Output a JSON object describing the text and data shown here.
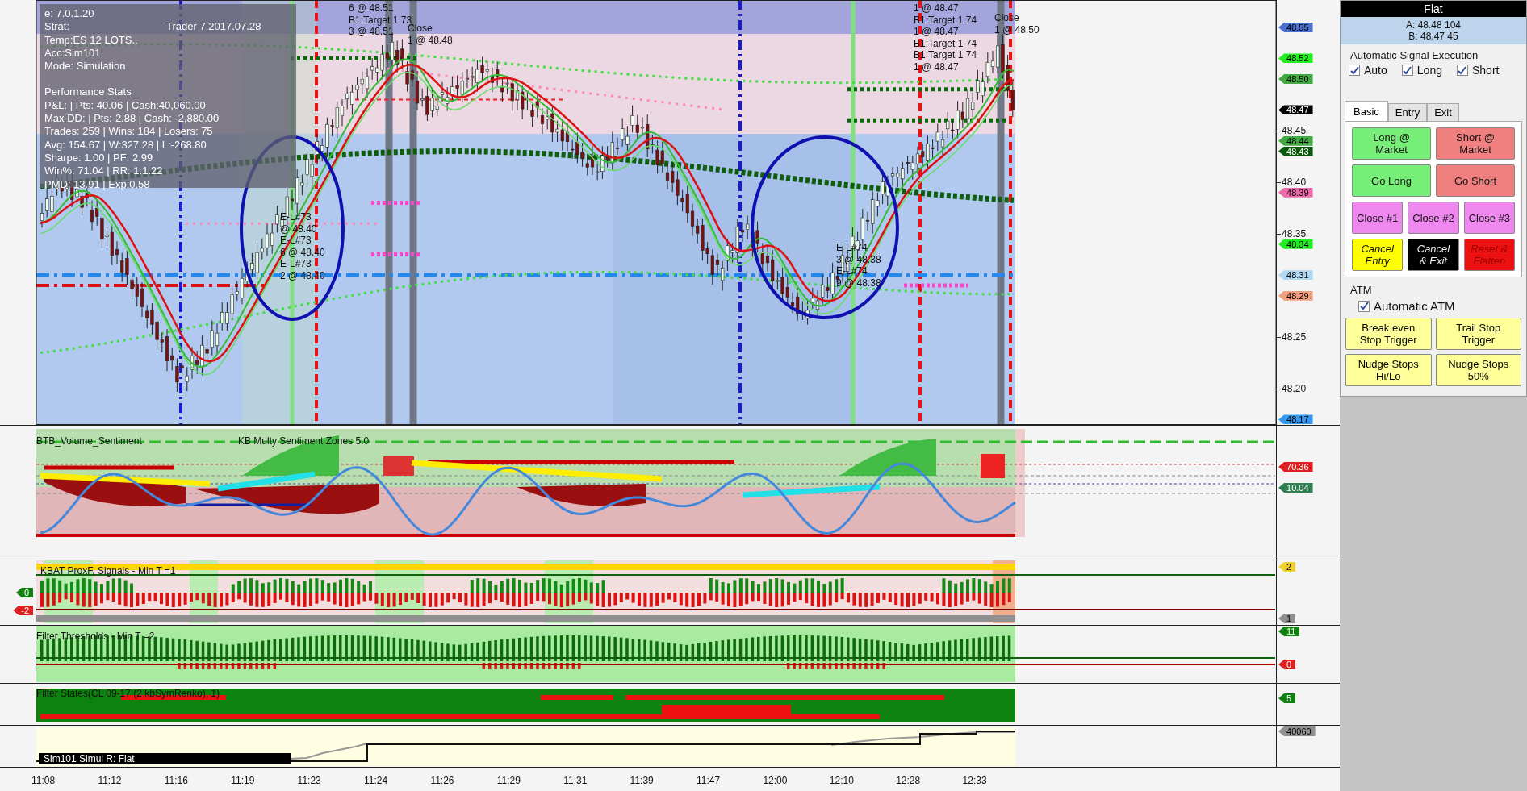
{
  "info_box": {
    "lines": [
      [
        "e: 7.0.1.20"
      ],
      [
        "Strat:",
        "Trader 7.2017.07.28"
      ],
      [
        "Temp:ES 12 LOTS.."
      ],
      [
        "Acc:Sim101"
      ],
      [
        "Mode: Simulation"
      ],
      [
        "Performance Stats"
      ],
      [
        "P&L: | Pts: 40.06 | Cash:40,060.00"
      ],
      [
        "Max DD: | Pts:-2.88 | Cash: -2,880.00"
      ],
      [
        "Trades: 259 | Wins: 184 | Losers: 75"
      ],
      [
        "Avg: 154.67 | W:327.28 | L:-268.80"
      ],
      [
        "Sharpe: 1.00 | PF: 2.99"
      ],
      [
        "Win%: 71.04 | RR: 1:1.22"
      ],
      [
        "PMD: 13.91 | Exp:0.58"
      ]
    ]
  },
  "trade_labels": [
    {
      "lines": [
        "6 @ 48.51",
        "B1:Target 1 73",
        "3 @ 48.51"
      ]
    },
    {
      "lines": [
        "Close",
        "1 @ 48.48"
      ]
    },
    {
      "lines": [
        "E-L#73",
        "@ 48.40",
        "E-L#73",
        "6 @ 48.40",
        "E-L#73",
        "2 @ 48.40"
      ]
    },
    {
      "lines": [
        "E-L#74",
        "3 @ 48.38",
        "E-L#74",
        "9 @ 48.38"
      ]
    },
    {
      "lines": [
        "1 @ 48.47",
        "B1:Target 1 74",
        "1 @ 48.47",
        "B1:Target 1 74",
        "B1:Target 1 74",
        "1 @ 48.47"
      ]
    },
    {
      "lines": [
        "Close",
        "1 @ 48.50"
      ]
    }
  ],
  "price_axis": {
    "ticks": [
      "48.45",
      "48.40",
      "48.35",
      "48.25",
      "48.20"
    ],
    "markers": [
      {
        "text": "48.55",
        "color": "#4a70d0"
      },
      {
        "text": "48.52",
        "color": "#22ee22"
      },
      {
        "text": "48.50",
        "color": "#44aa44"
      },
      {
        "text": "48.47",
        "color": "#000000"
      },
      {
        "text": "48.44",
        "color": "#44aa44"
      },
      {
        "text": "48.43",
        "color": "#0b5a0b"
      },
      {
        "text": "48.39",
        "color": "#ee6aaa"
      },
      {
        "text": "48.34",
        "color": "#22ee22"
      },
      {
        "text": "48.31",
        "color": "#b0d8f0"
      },
      {
        "text": "48.29",
        "color": "#f0a080"
      },
      {
        "text": "48.17",
        "color": "#3399ee"
      }
    ]
  },
  "panels": [
    {
      "labels": [
        "BTB_Volume_Sentiment",
        "KB Multy Sentiment Zones 5.0"
      ],
      "markers": [
        {
          "text": "70.36",
          "color": "#e02020"
        },
        {
          "text": "10.04",
          "color": "#2e8050"
        }
      ]
    },
    {
      "labels": [
        "KBAT ProxF, Signals - Min T =1"
      ],
      "markers": [
        {
          "text": "2",
          "color": "#f0d030"
        },
        {
          "text": "1",
          "color": "#909090"
        }
      ],
      "left_markers": [
        {
          "text": "0",
          "color": "#108010"
        },
        {
          "text": "-2",
          "color": "#e02020"
        }
      ]
    },
    {
      "labels": [
        "Filter Thresholds - Min T =2"
      ],
      "markers": [
        {
          "text": "11",
          "color": "#108010"
        },
        {
          "text": "0",
          "color": "#e02020"
        }
      ]
    },
    {
      "labels": [
        "Filter States(CL 09-17 (2 kbSymRenko), 1)"
      ],
      "markers": [
        {
          "text": "5",
          "color": "#108010"
        }
      ]
    },
    {
      "labels": [
        "Sim101 Simul  R: Flat"
      ],
      "markers": [
        {
          "text": "40060",
          "color": "#909090"
        }
      ]
    }
  ],
  "time_axis": [
    "11:08",
    "11:12",
    "11:16",
    "11:19",
    "11:23",
    "11:24",
    "11:26",
    "11:29",
    "11:31",
    "11:39",
    "11:47",
    "12:00",
    "12:10",
    "12:28",
    "12:33"
  ],
  "control_panel": {
    "status": "Flat",
    "ask": "A: 48.48 104",
    "bid": "B: 48.47 45",
    "auto_title": "Automatic Signal Execution",
    "auto_options": [
      {
        "label": "Auto",
        "checked": true
      },
      {
        "label": "Long",
        "checked": true
      },
      {
        "label": "Short",
        "checked": true
      }
    ],
    "tabs": [
      {
        "label": "Basic",
        "selected": true
      },
      {
        "label": "Entry",
        "selected": false
      },
      {
        "label": "Exit",
        "selected": false
      }
    ],
    "button_rows": [
      [
        {
          "label": "Long @\nMarket",
          "kind": "long"
        },
        {
          "label": "Short @\nMarket",
          "kind": "short"
        }
      ],
      [
        {
          "label": "Go Long",
          "kind": "long"
        },
        {
          "label": "Go Short",
          "kind": "short"
        }
      ],
      [
        {
          "label": "Close #1",
          "kind": "close"
        },
        {
          "label": "Close #2",
          "kind": "close"
        },
        {
          "label": "Close #3",
          "kind": "close"
        }
      ],
      [
        {
          "label": "Cancel\nEntry",
          "kind": "cancel_entry"
        },
        {
          "label": "Cancel\n& Exit",
          "kind": "cancel_exit"
        },
        {
          "label": "Reset &\nFlatten",
          "kind": "reset"
        }
      ]
    ],
    "atm_title": "ATM",
    "atm_option": {
      "label": "Automatic ATM",
      "checked": true
    },
    "atm_buttons": [
      {
        "label": "Break even\nStop Trigger",
        "kind": "atm"
      },
      {
        "label": "Trail Stop\nTrigger",
        "kind": "atm"
      },
      {
        "label": "Nudge Stops\nHi/Lo",
        "kind": "atm"
      },
      {
        "label": "Nudge Stops\n50%",
        "kind": "atm"
      }
    ]
  }
}
